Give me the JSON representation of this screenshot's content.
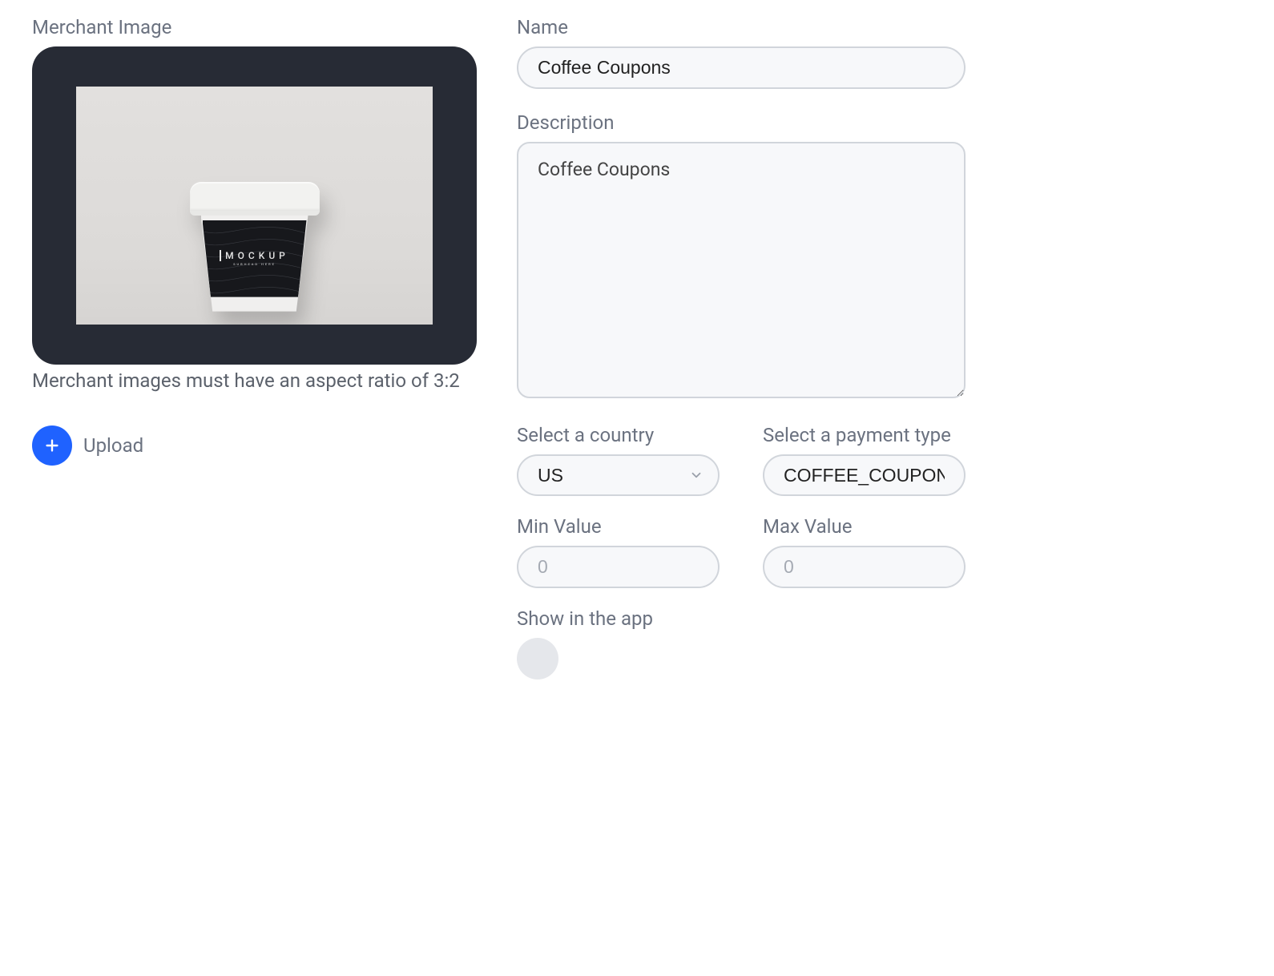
{
  "left": {
    "label": "Merchant Image",
    "hint": "Merchant images must have an aspect ratio of 3:2",
    "upload_label": "Upload",
    "mockup_text": "MOCKUP",
    "mockup_sub": "SUBHEAD HERE"
  },
  "form": {
    "name": {
      "label": "Name",
      "value": "Coffee Coupons"
    },
    "description": {
      "label": "Description",
      "value": "Coffee Coupons"
    },
    "country": {
      "label": "Select a country",
      "value": "US"
    },
    "payment": {
      "label": "Select a payment type",
      "value": "COFFEE_COUPON"
    },
    "min": {
      "label": "Min Value",
      "placeholder": "0",
      "value": ""
    },
    "max": {
      "label": "Max Value",
      "placeholder": "0",
      "value": ""
    },
    "show": {
      "label": "Show in the app",
      "value": false
    }
  }
}
